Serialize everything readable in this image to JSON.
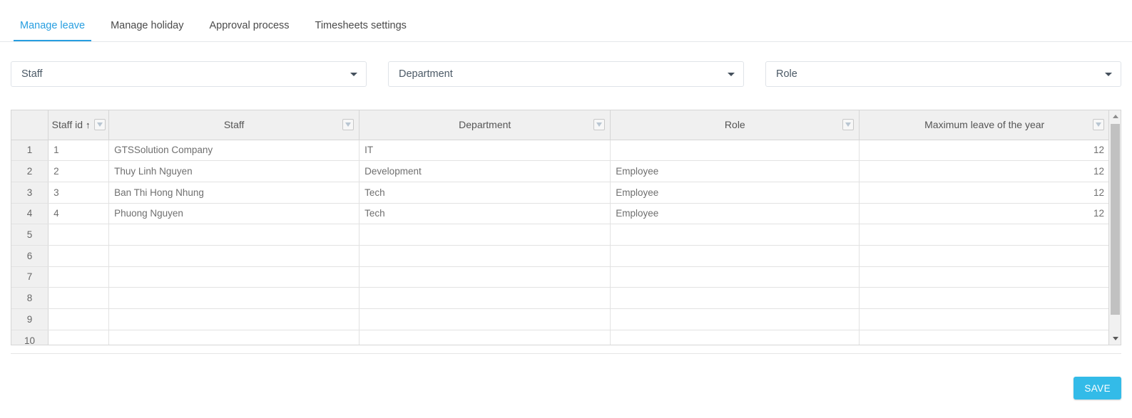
{
  "tabs": [
    {
      "label": "Manage leave",
      "active": true
    },
    {
      "label": "Manage holiday",
      "active": false
    },
    {
      "label": "Approval process",
      "active": false
    },
    {
      "label": "Timesheets settings",
      "active": false
    }
  ],
  "filters": [
    {
      "name": "staff",
      "value": "Staff"
    },
    {
      "name": "department",
      "value": "Department"
    },
    {
      "name": "role",
      "value": "Role"
    }
  ],
  "grid": {
    "columns": [
      {
        "key": "rownum",
        "label": "",
        "filterable": false,
        "sorted": null
      },
      {
        "key": "staff_id",
        "label": "Staff id",
        "filterable": true,
        "sorted": "asc",
        "sort_glyph": "↑"
      },
      {
        "key": "staff",
        "label": "Staff",
        "filterable": true,
        "sorted": null
      },
      {
        "key": "department",
        "label": "Department",
        "filterable": true,
        "sorted": null
      },
      {
        "key": "role",
        "label": "Role",
        "filterable": true,
        "sorted": null
      },
      {
        "key": "max_leave",
        "label": "Maximum leave of the year",
        "filterable": true,
        "sorted": null
      }
    ],
    "rows": [
      {
        "rownum": "1",
        "staff_id": "1",
        "staff": "GTSSolution Company",
        "department": "IT",
        "role": "",
        "max_leave": "12"
      },
      {
        "rownum": "2",
        "staff_id": "2",
        "staff": "Thuy Linh Nguyen",
        "department": "Development",
        "role": "Employee",
        "max_leave": "12"
      },
      {
        "rownum": "3",
        "staff_id": "3",
        "staff": "Ban Thi Hong Nhung",
        "department": "Tech",
        "role": "Employee",
        "max_leave": "12"
      },
      {
        "rownum": "4",
        "staff_id": "4",
        "staff": "Phuong Nguyen",
        "department": "Tech",
        "role": "Employee",
        "max_leave": "12"
      },
      {
        "rownum": "5",
        "staff_id": "",
        "staff": "",
        "department": "",
        "role": "",
        "max_leave": ""
      },
      {
        "rownum": "6",
        "staff_id": "",
        "staff": "",
        "department": "",
        "role": "",
        "max_leave": ""
      },
      {
        "rownum": "7",
        "staff_id": "",
        "staff": "",
        "department": "",
        "role": "",
        "max_leave": ""
      },
      {
        "rownum": "8",
        "staff_id": "",
        "staff": "",
        "department": "",
        "role": "",
        "max_leave": ""
      },
      {
        "rownum": "9",
        "staff_id": "",
        "staff": "",
        "department": "",
        "role": "",
        "max_leave": ""
      },
      {
        "rownum": "10",
        "staff_id": "",
        "staff": "",
        "department": "",
        "role": "",
        "max_leave": ""
      }
    ]
  },
  "footer": {
    "save_label": "SAVE"
  },
  "colors": {
    "accent_tab": "#279ee0",
    "save_button": "#33bbe8",
    "header_bg": "#f0f0f0",
    "border": "#d6d6d6"
  }
}
